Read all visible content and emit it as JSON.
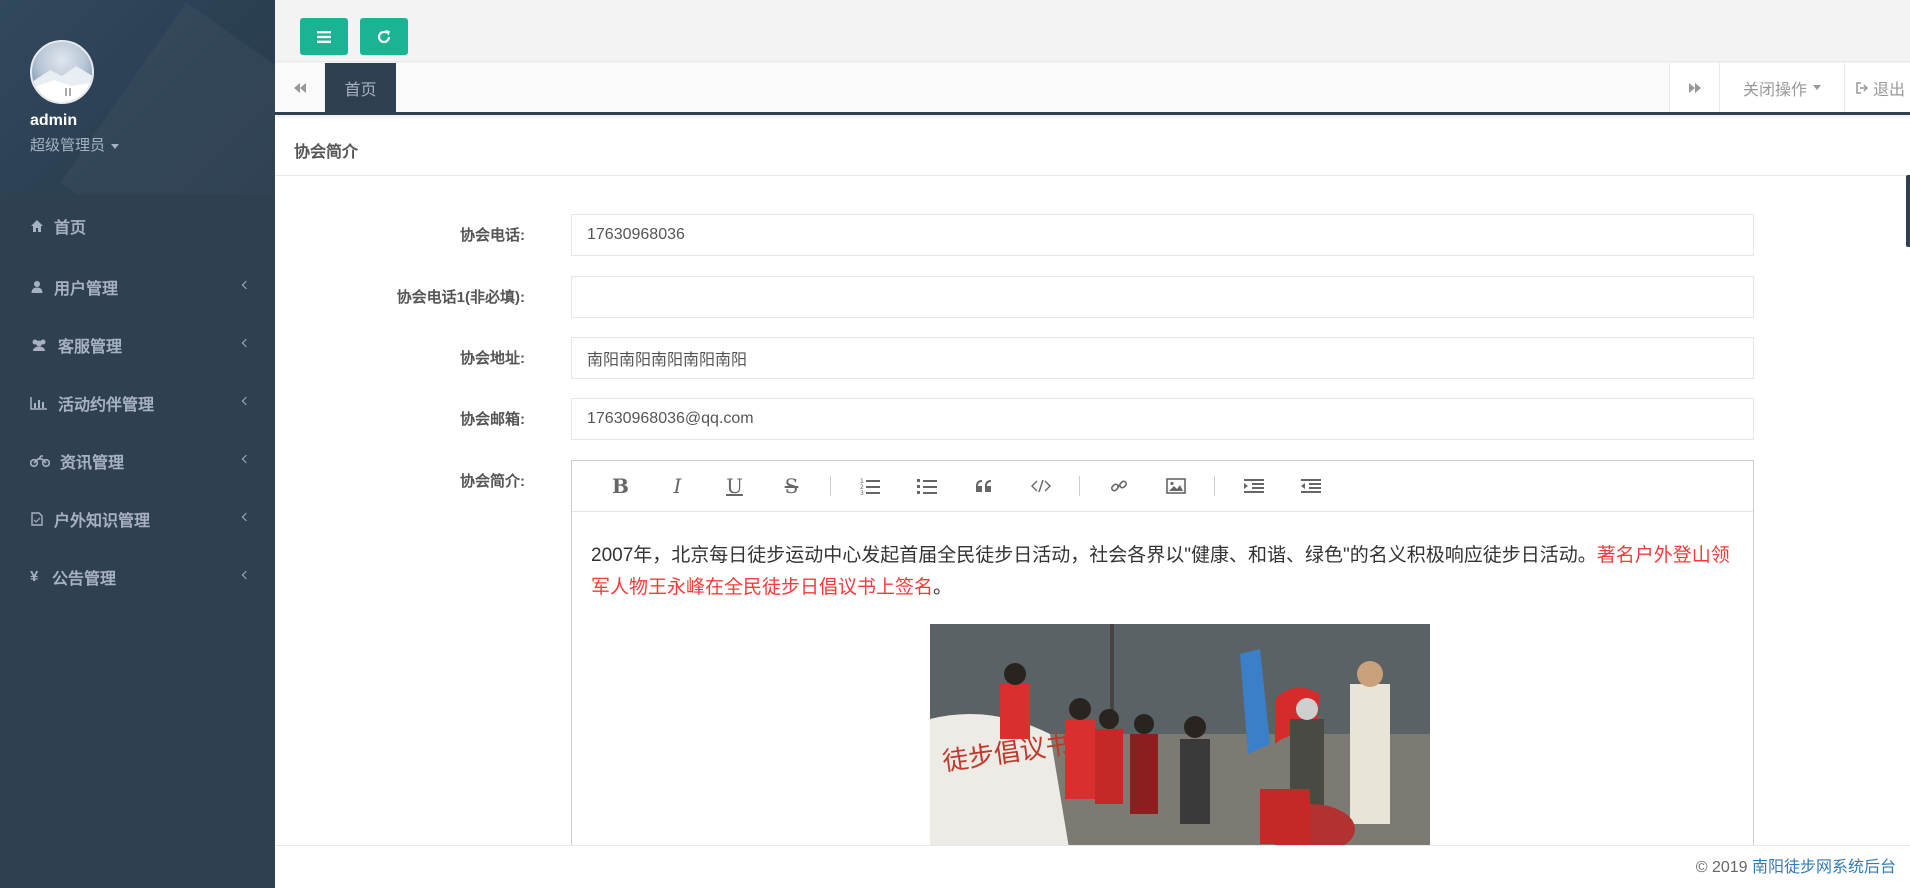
{
  "sidebar": {
    "user": {
      "name": "admin",
      "role": "超级管理员"
    },
    "items": [
      {
        "label": "首页",
        "icon": "home-icon",
        "has_arrow": false
      },
      {
        "label": "用户管理",
        "icon": "user-icon",
        "has_arrow": true
      },
      {
        "label": "客服管理",
        "icon": "users-icon",
        "has_arrow": true
      },
      {
        "label": "活动约伴管理",
        "icon": "bar-chart-icon",
        "has_arrow": true
      },
      {
        "label": "资讯管理",
        "icon": "motorcycle-icon",
        "has_arrow": true
      },
      {
        "label": "户外知识管理",
        "icon": "file-icon",
        "has_arrow": true
      },
      {
        "label": "公告管理",
        "icon": "yen-icon",
        "has_arrow": true
      }
    ]
  },
  "tabs": {
    "active": "首页",
    "close_ops": "关闭操作",
    "logout": "退出"
  },
  "content": {
    "title": "协会简介",
    "fields": {
      "phone": {
        "label": "协会电话:",
        "value": "17630968036"
      },
      "phone2": {
        "label": "协会电话1(非必填):",
        "value": ""
      },
      "address": {
        "label": "协会地址:",
        "value": "南阳南阳南阳南阳南阳"
      },
      "email": {
        "label": "协会邮箱:",
        "value": "17630968036@qq.com"
      },
      "intro": {
        "label": "协会简介:"
      }
    },
    "editor": {
      "text_plain": "2007年，北京每日徒步运动中心发起首届全民徒步日活动，社会各界以\"健康、和谐、绿色\"的名义积极响应徒步日活动。",
      "text_red": "著名户外登山领军人物王永峰在全民徒步日倡议书上签名",
      "text_end": "。"
    }
  },
  "footer": {
    "copyright": "© 2019",
    "link_text": "南阳徒步网系统后台"
  },
  "colors": {
    "sidebar_bg": "#2f4050",
    "accent": "#1ab394",
    "highlight_red": "#f53b3b",
    "link": "#337ab7"
  }
}
